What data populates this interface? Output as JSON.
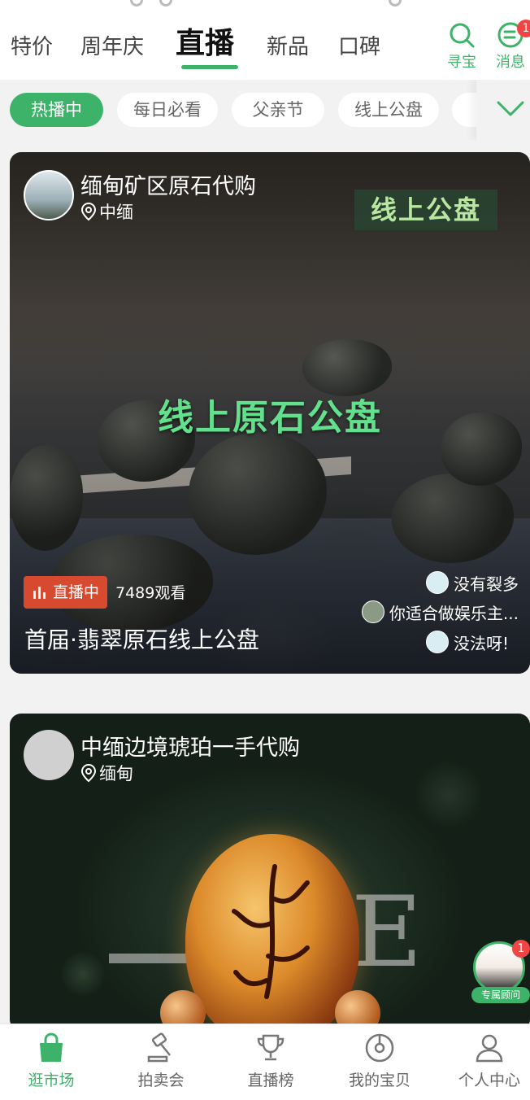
{
  "top_nav": {
    "tabs": [
      {
        "label": "特价"
      },
      {
        "label": "周年庆"
      },
      {
        "label": "直播"
      },
      {
        "label": "新品"
      },
      {
        "label": "口碑"
      }
    ],
    "active_tab": "直播",
    "search": {
      "label": "寻宝",
      "icon": "search-icon"
    },
    "messages": {
      "label": "消息",
      "icon": "message-icon",
      "badge": "1"
    }
  },
  "filter_chips": [
    {
      "label": "热播中",
      "active": true
    },
    {
      "label": "每日必看"
    },
    {
      "label": "父亲节"
    },
    {
      "label": "线上公盘"
    }
  ],
  "live_cards": [
    {
      "seller_name": "缅甸矿区原石代购",
      "location": "中缅",
      "corner_tag": "线上公盘",
      "center_title": "线上原石公盘",
      "live_label": "直播中",
      "viewers": "7489观看",
      "title": "首届·翡翠原石线上公盘",
      "comments": [
        "没有裂多",
        "你适合做娱乐主...",
        "没法呀!"
      ]
    },
    {
      "seller_name": "中缅边境琥珀一手代购",
      "location": "缅甸"
    }
  ],
  "consultant": {
    "label": "专属顾问",
    "badge": "1"
  },
  "bottom_nav": [
    {
      "label": "逛市场",
      "icon": "shopping-bag-icon",
      "active": true
    },
    {
      "label": "拍卖会",
      "icon": "gavel-icon"
    },
    {
      "label": "直播榜",
      "icon": "trophy-icon"
    },
    {
      "label": "我的宝贝",
      "icon": "treasure-icon"
    },
    {
      "label": "个人中心",
      "icon": "user-icon"
    }
  ],
  "colors": {
    "accent": "#3db36a",
    "live_red": "#d84a2f",
    "badge_red": "#f04545"
  }
}
